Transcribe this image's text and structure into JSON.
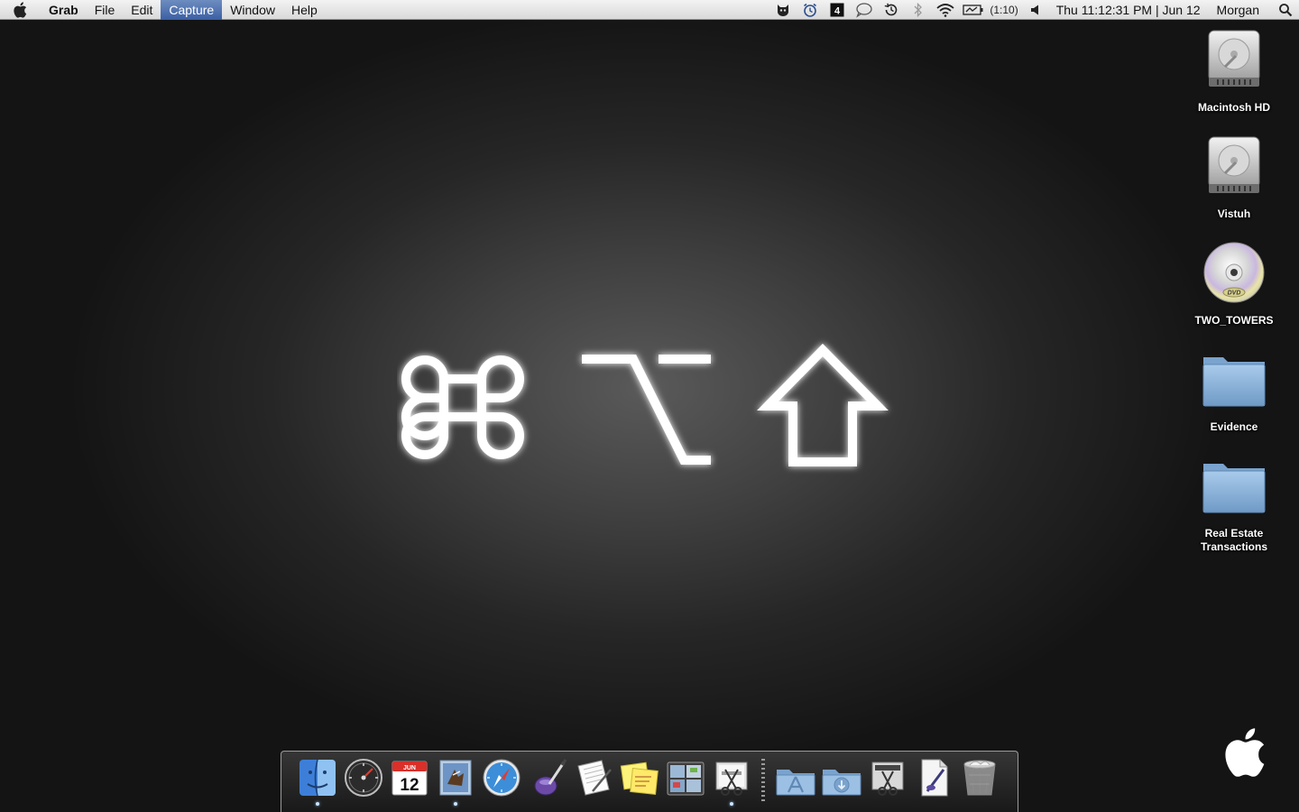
{
  "menubar": {
    "app_name": "Grab",
    "menus": [
      "File",
      "Edit",
      "Capture",
      "Window",
      "Help"
    ],
    "active_menu": "Capture",
    "status_icons": [
      "growl-icon",
      "alarm-icon",
      "spaces-icon",
      "ichat-icon",
      "time-machine-icon",
      "bluetooth-icon",
      "wifi-icon",
      "battery-icon",
      "volume-icon"
    ],
    "battery_time": "(1:10)",
    "clock": "Thu 11:12:31 PM | Jun 12",
    "user": "Morgan"
  },
  "center_glyphs": [
    "command-symbol",
    "option-symbol",
    "shift-symbol"
  ],
  "desktop_icons": [
    {
      "label": "Macintosh HD",
      "icon": "hard-drive-icon"
    },
    {
      "label": "Vistuh",
      "icon": "hard-drive-icon"
    },
    {
      "label": "TWO_TOWERS",
      "icon": "dvd-icon"
    },
    {
      "label": "Evidence",
      "icon": "folder-icon"
    },
    {
      "label": "Real Estate Transactions",
      "icon": "folder-icon"
    }
  ],
  "dock": {
    "apps": [
      {
        "name": "finder-icon",
        "running": true
      },
      {
        "name": "dashboard-icon",
        "running": false
      },
      {
        "name": "ical-icon",
        "running": false,
        "badge_month": "JUN",
        "badge_day": "12"
      },
      {
        "name": "mail-icon",
        "running": true
      },
      {
        "name": "safari-icon",
        "running": false
      },
      {
        "name": "script-editor-icon",
        "running": false
      },
      {
        "name": "textedit-icon",
        "running": false
      },
      {
        "name": "stickies-icon",
        "running": false
      },
      {
        "name": "spaces-icon",
        "running": false
      },
      {
        "name": "grab-icon",
        "running": true
      }
    ],
    "stacks": [
      "applications-folder-icon",
      "downloads-folder-icon",
      "screenshot-tool-icon",
      "document-icon",
      "trash-icon"
    ]
  },
  "colors": {
    "menu_highlight": "#3b5fa3",
    "folder_blue": "#8fb6dc"
  }
}
